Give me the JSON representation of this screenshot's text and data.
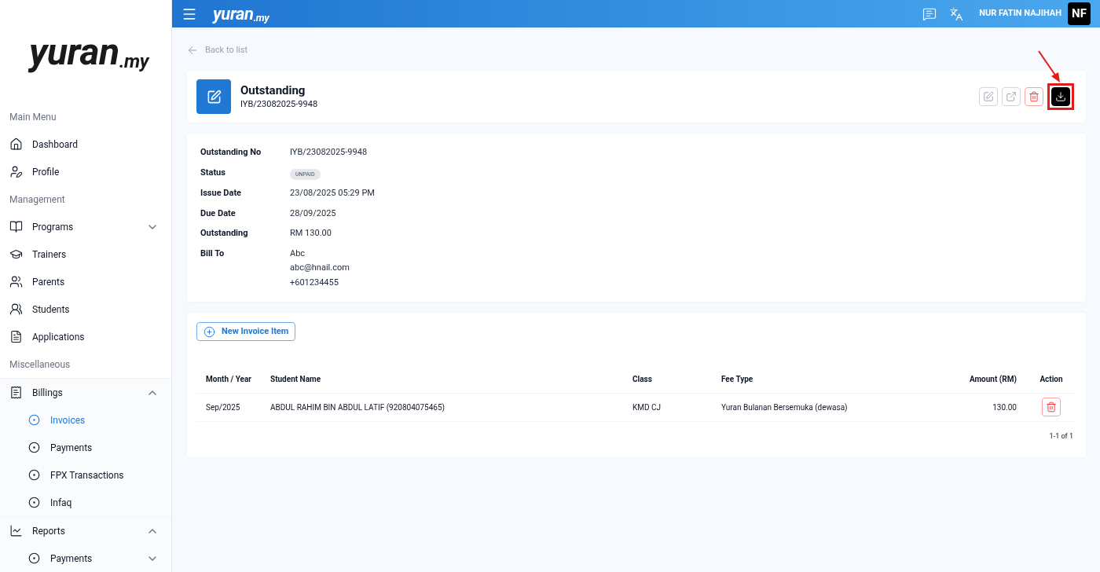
{
  "sidebar": {
    "logo": {
      "main": "yuran",
      "suffix": ".my"
    },
    "sections": [
      {
        "title": "Main Menu",
        "items": [
          {
            "label": "Dashboard"
          },
          {
            "label": "Profile"
          }
        ]
      },
      {
        "title": "Management",
        "items": [
          {
            "label": "Programs",
            "expanded": false
          },
          {
            "label": "Trainers"
          },
          {
            "label": "Parents"
          },
          {
            "label": "Students"
          },
          {
            "label": "Applications"
          }
        ]
      },
      {
        "title": "Miscellaneous",
        "items": [
          {
            "label": "Billings",
            "expanded": true,
            "children": [
              {
                "label": "Invoices",
                "selected": true
              },
              {
                "label": "Payments",
                "selected": false
              },
              {
                "label": "FPX Transactions",
                "selected": false
              },
              {
                "label": "Infaq",
                "selected": false
              }
            ]
          },
          {
            "label": "Reports",
            "expanded": true,
            "children": [
              {
                "label": "Payments",
                "selected": false,
                "expanded": false
              }
            ]
          }
        ]
      }
    ]
  },
  "topbar": {
    "logo": {
      "main": "yuran",
      "suffix": ".my"
    },
    "user_name": "NUR FATIN NAJIHAH",
    "avatar": "NF"
  },
  "back_link": "Back to list",
  "header": {
    "title": "Outstanding",
    "number": "IYB/23082025-9948",
    "actions": [
      {
        "kind": "edit"
      },
      {
        "kind": "open"
      },
      {
        "kind": "delete"
      },
      {
        "kind": "download",
        "highlighted": true
      }
    ]
  },
  "details": [
    {
      "label": "Outstanding No",
      "kind": "text",
      "value": [
        "IYB/23082025-9948"
      ]
    },
    {
      "label": "Status",
      "kind": "badge",
      "value": [
        "UNPAID"
      ]
    },
    {
      "label": "Issue Date",
      "kind": "text",
      "value": [
        "23/08/2025 05:29 PM"
      ]
    },
    {
      "label": "Due Date",
      "kind": "text",
      "value": [
        "28/09/2025"
      ]
    },
    {
      "label": "Outstanding",
      "kind": "text",
      "value": [
        "RM 130.00"
      ]
    },
    {
      "label": "Bill To",
      "kind": "text",
      "value": [
        "Abc",
        "abc@hnail.com",
        "+601234455"
      ]
    }
  ],
  "items": {
    "new_button": "New Invoice Item",
    "columns": [
      "Month / Year",
      "Student Name",
      "Class",
      "Fee Type",
      "Amount (RM)",
      "Action"
    ],
    "rows": [
      {
        "month": "Sep/2025",
        "student": "ABDUL RAHIM BIN ABDUL LATIF (920804075465)",
        "class": "KMD CJ",
        "fee_type": "Yuran Bulanan Bersemuka (dewasa)",
        "amount": "130.00"
      }
    ],
    "pagination": "1-1 of 1"
  }
}
